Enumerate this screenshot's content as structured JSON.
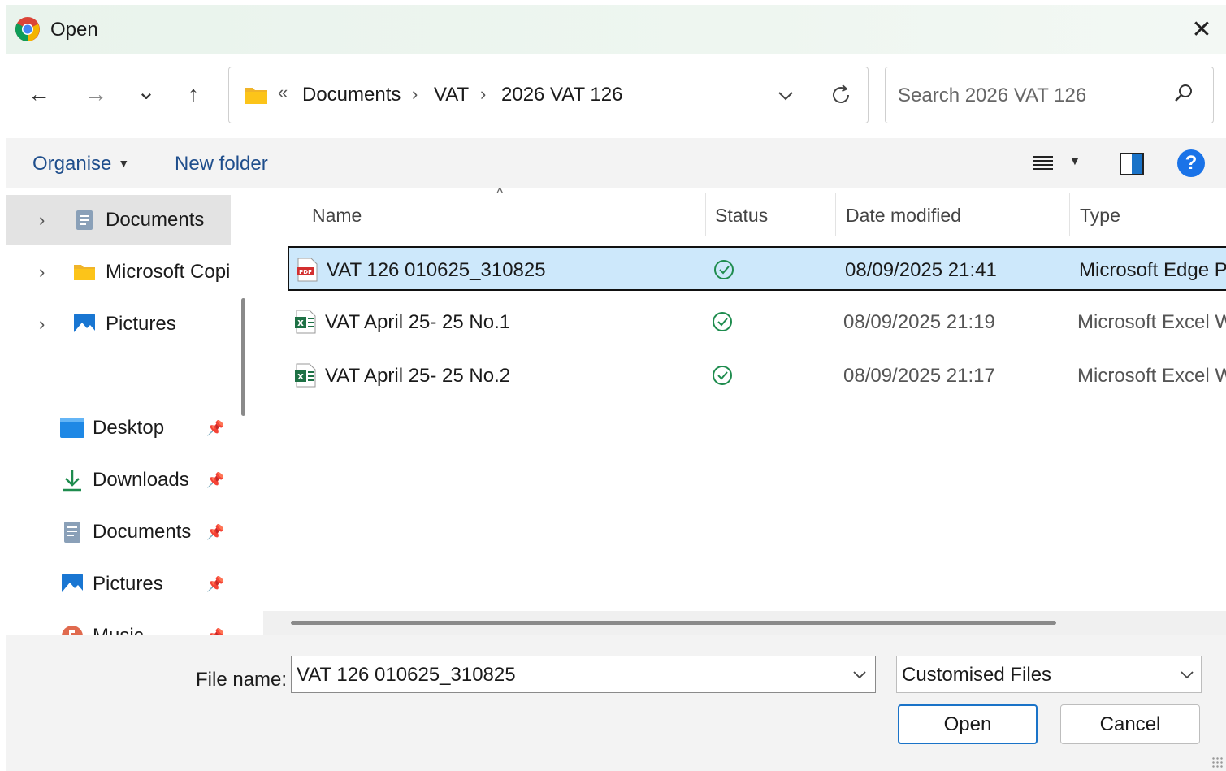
{
  "dialog": {
    "title": "Open",
    "close_label": "✕"
  },
  "nav": {
    "back": "←",
    "forward": "→",
    "recent": "⌄",
    "up": "↑",
    "breadcrumb": {
      "overflow": "«",
      "items": [
        "Documents",
        "VAT",
        "2026 VAT 126"
      ],
      "separator": "›"
    },
    "search_placeholder": "Search 2026 VAT 126"
  },
  "toolbar": {
    "organise": "Organise",
    "new_folder": "New folder",
    "help": "?"
  },
  "sidebar": {
    "tree": [
      {
        "label": "Documents",
        "selected": true,
        "icon": "documents-icon"
      },
      {
        "label": "Microsoft Copi",
        "selected": false,
        "icon": "folder-icon"
      },
      {
        "label": "Pictures",
        "selected": false,
        "icon": "pictures-icon"
      }
    ],
    "quick_access": [
      {
        "label": "Desktop",
        "icon": "desktop-icon"
      },
      {
        "label": "Downloads",
        "icon": "downloads-icon"
      },
      {
        "label": "Documents",
        "icon": "documents-icon"
      },
      {
        "label": "Pictures",
        "icon": "pictures-icon"
      },
      {
        "label": "Music",
        "icon": "music-icon"
      }
    ]
  },
  "files": {
    "columns": [
      "Name",
      "Status",
      "Date modified",
      "Type"
    ],
    "rows": [
      {
        "name": "VAT 126 010625_310825",
        "icon": "pdf-icon",
        "status": "synced",
        "date": "08/09/2025 21:41",
        "type": "Microsoft Edge P",
        "selected": true
      },
      {
        "name": "VAT April 25-  25 No.1",
        "icon": "excel-icon",
        "status": "synced",
        "date": "08/09/2025 21:19",
        "type": "Microsoft Excel W",
        "selected": false
      },
      {
        "name": "VAT April 25-  25 No.2",
        "icon": "excel-icon",
        "status": "synced",
        "date": "08/09/2025 21:17",
        "type": "Microsoft Excel W",
        "selected": false
      }
    ]
  },
  "bottom": {
    "file_name_label": "File name:",
    "file_name_value": "VAT 126 010625_310825",
    "file_type": "Customised Files",
    "open_label": "Open",
    "cancel_label": "Cancel"
  },
  "colors": {
    "selection": "#cde8fb",
    "accent": "#1a73c8",
    "status_green": "#1e8c4e"
  }
}
